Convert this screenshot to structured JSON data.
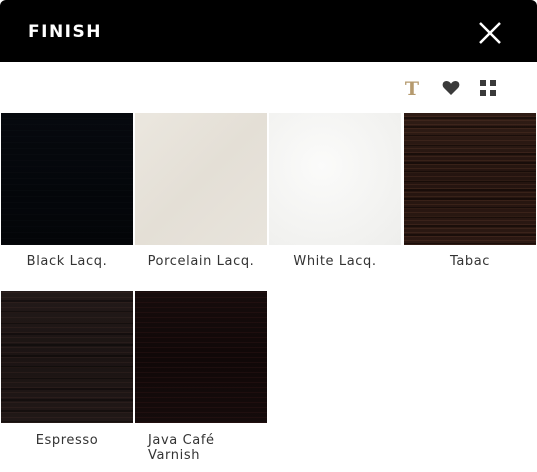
{
  "header": {
    "title": "FINISH",
    "close_icon": "close-icon"
  },
  "toolbar": {
    "icons": [
      "text-icon",
      "heart-icon",
      "grid-icon"
    ],
    "text_icon_glyph": "T",
    "text_icon_color": "#b59a6e",
    "icon_color": "#3a3a3a"
  },
  "finishes": [
    {
      "label": "Black Lacq."
    },
    {
      "label": "Porcelain Lacq."
    },
    {
      "label": "White Lacq."
    },
    {
      "label": "Tabac"
    },
    {
      "label": "Espresso"
    },
    {
      "label": "Java Café Varnish"
    }
  ],
  "colors": {
    "header_bg": "#000000",
    "header_text": "#ffffff",
    "label_text": "#333333"
  }
}
